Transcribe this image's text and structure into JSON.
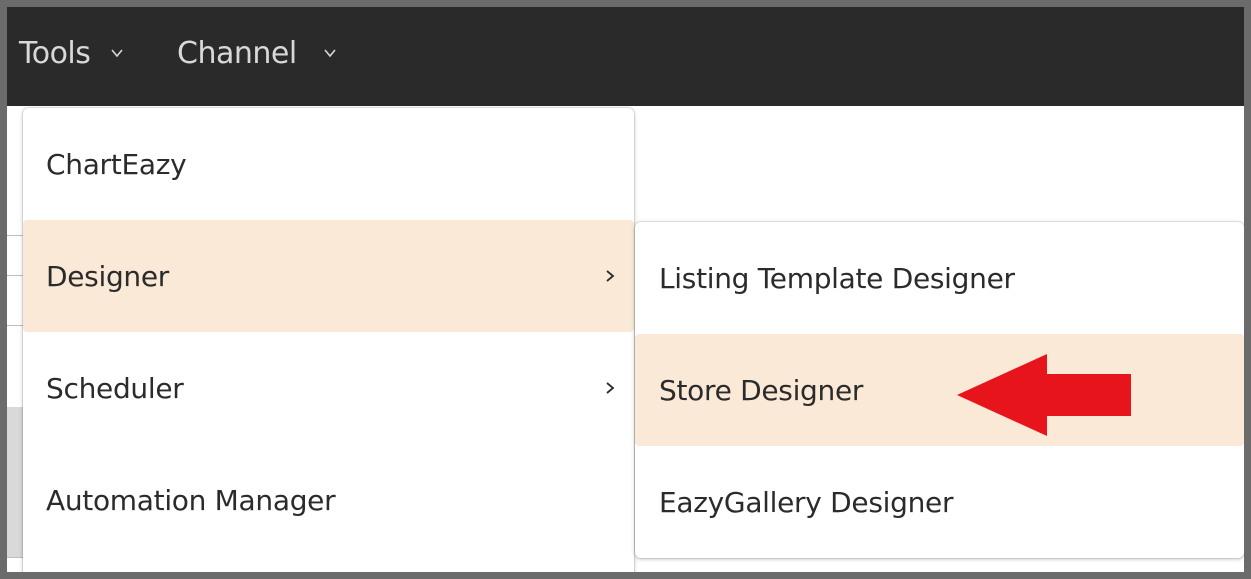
{
  "topbar": {
    "tools_label": "Tools",
    "channel_label": "Channel"
  },
  "menu": {
    "items": [
      {
        "label": "ChartEazy",
        "has_submenu": false
      },
      {
        "label": "Designer",
        "has_submenu": true,
        "highlighted": true
      },
      {
        "label": "Scheduler",
        "has_submenu": true
      },
      {
        "label": "Automation Manager",
        "has_submenu": false
      }
    ]
  },
  "submenu": {
    "items": [
      {
        "label": "Listing Template Designer"
      },
      {
        "label": "Store Designer",
        "highlighted": true
      },
      {
        "label": "EazyGallery Designer"
      }
    ]
  },
  "icons": {
    "dropdown": "chevron-down-icon",
    "submenu_arrow": "chevron-right-icon",
    "annotation": "red-arrow-icon"
  },
  "colors": {
    "topbar_bg": "#2a2a2a",
    "highlight_bg": "#fae9d7",
    "annotation_red": "#e8141c"
  }
}
